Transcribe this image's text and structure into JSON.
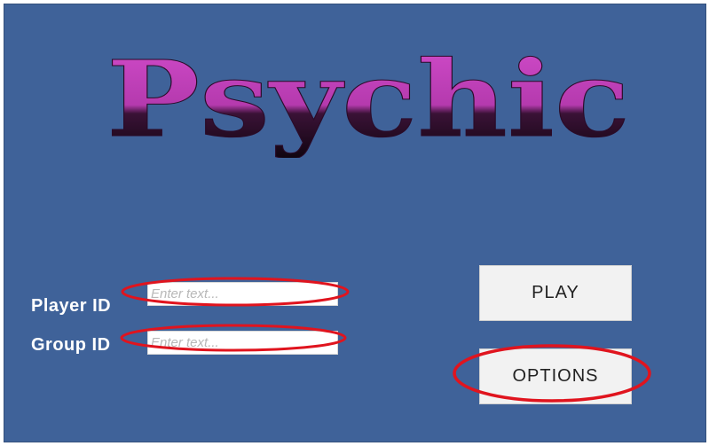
{
  "title": {
    "text": "Psychic"
  },
  "form": {
    "player_id_label": "Player ID",
    "player_id_placeholder": "Enter text...",
    "player_id_value": "",
    "group_id_label": "Group ID",
    "group_id_placeholder": "Enter text...",
    "group_id_value": ""
  },
  "buttons": {
    "play_label": "PLAY",
    "options_label": "OPTIONS"
  },
  "colors": {
    "background": "#3f6299",
    "title_top": "#c040b8",
    "title_bottom": "#120612",
    "highlight": "#e0141e"
  }
}
